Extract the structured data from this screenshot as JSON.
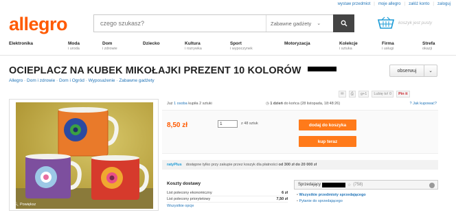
{
  "toplinks": [
    "wystaw przedmiot",
    "moje allegro",
    "załóż konto",
    "zaloguj"
  ],
  "logo": "allegro",
  "search": {
    "placeholder": "czego szukasz?",
    "category": "Zabawne gadżety"
  },
  "cart_text": "koszyk jest pusty",
  "categories": [
    {
      "name": "Elektronika",
      "sub": ""
    },
    {
      "name": "Moda",
      "sub": "i uroda"
    },
    {
      "name": "Dom",
      "sub": "i zdrowie"
    },
    {
      "name": "Dziecko",
      "sub": ""
    },
    {
      "name": "Kultura",
      "sub": "i rozrywka"
    },
    {
      "name": "Sport",
      "sub": "i wypoczynek"
    },
    {
      "name": "Motoryzacja",
      "sub": ""
    },
    {
      "name": "Kolekcje",
      "sub": "i sztuka"
    },
    {
      "name": "Firma",
      "sub": "i usługi"
    },
    {
      "name": "Strefa",
      "sub": "okazji"
    }
  ],
  "product": {
    "title": "OCIEPLACZ NA KUBEK MIKOŁAJKI PREZENT 10 KOLORÓW",
    "breadcrumb": "Allegro · Dom i zdrowie · Dom i Ogród · Wyposażenie · Zabawne gadżety",
    "observe_label": "obserwuj",
    "zoom_label": "Powiększ",
    "social": {
      "like_label": "Lubię to!",
      "like_count": "0",
      "gplus": "g+1",
      "pinterest": "Pin it"
    },
    "bought_prefix": "Już",
    "bought_link": "1 osoba",
    "bought_suffix": "kupiła 2 sztuki",
    "time_left_bold": "1 dzień",
    "time_left_rest": "do końca (28 listopada, 18:48:26)",
    "help_link": "Jak kupować?",
    "price": "8,50 zł",
    "quantity": "1",
    "quantity_of": "z 48 sztuk",
    "add_to_cart": "dodaj do koszyka",
    "buy_now": "kup teraz",
    "raty_logo": "ratyPlus",
    "raty_text": "dostępne tylko przy zakupie przez koszyk dla płatności",
    "raty_range": "od 300 zł do 20 000 zł"
  },
  "shipping": {
    "title": "Koszty dostawy",
    "rows": [
      {
        "label": "List polecony ekonomiczny",
        "price": "6 zł"
      },
      {
        "label": "List polecony priorytetowy",
        "price": "7,50 zł"
      }
    ],
    "more": "Wszystkie opcje"
  },
  "seller": {
    "label": "Sprzedający",
    "rating": "(758)",
    "links": [
      "Wszystkie przedmioty sprzedającego",
      "Pytanie do sprzedającego"
    ]
  },
  "colors": {
    "brand": "#ff5a00",
    "link": "#1f73b7",
    "button": "#ff7a1a"
  }
}
